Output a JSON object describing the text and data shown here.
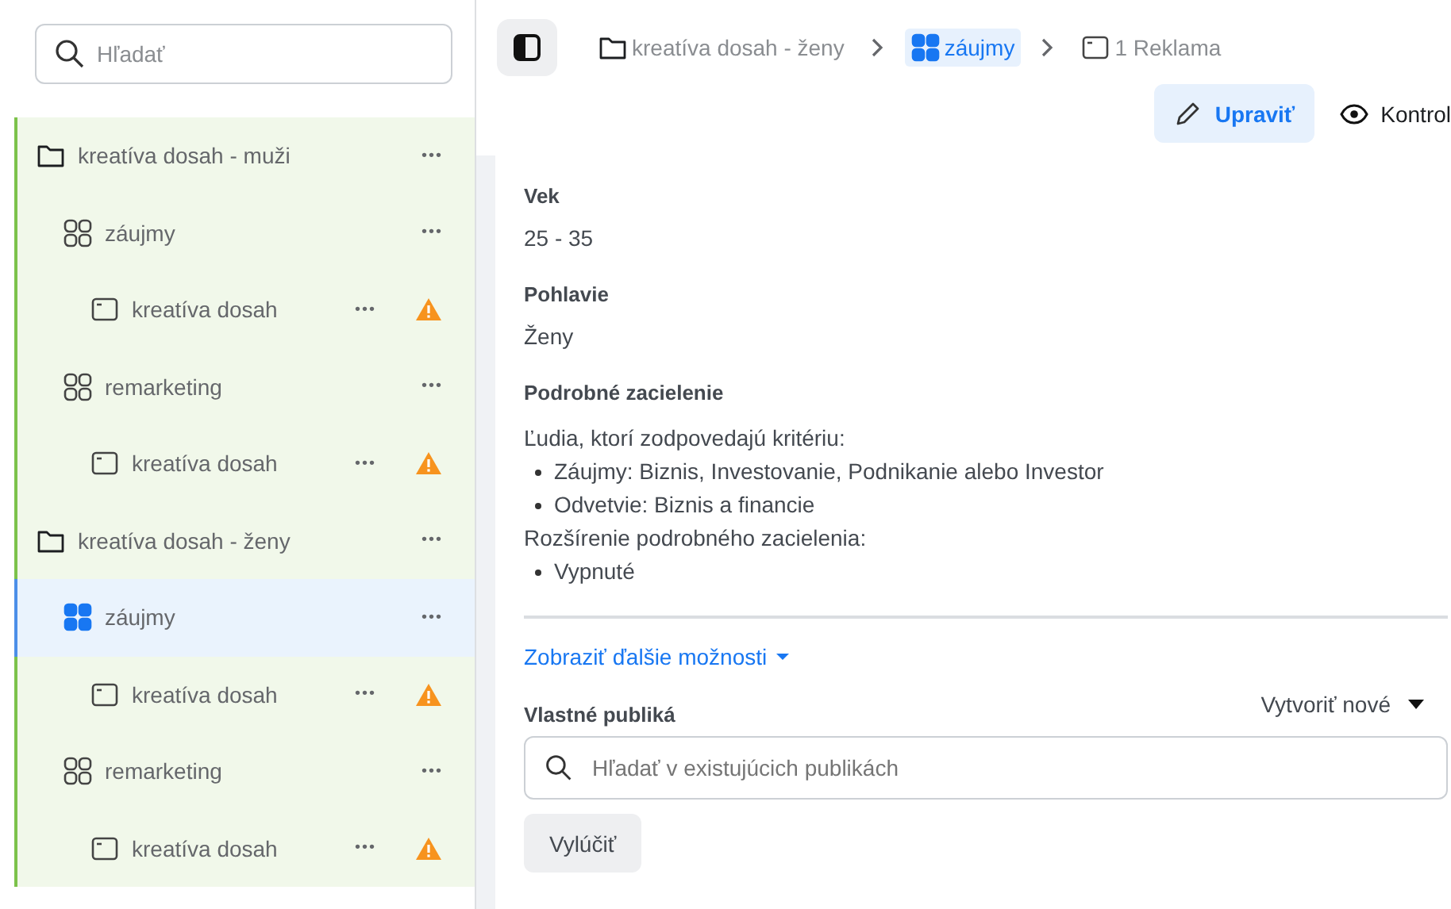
{
  "sidebar": {
    "search": {
      "placeholder": "Hľadať"
    },
    "tree": [
      {
        "kind": "folder",
        "label": "kreatíva dosah - muži",
        "selected": false,
        "more": "•••",
        "children": [
          {
            "kind": "adset",
            "label": "záujmy",
            "selected": false,
            "more": "•••",
            "children": [
              {
                "kind": "ad",
                "label": "kreatíva dosah",
                "selected": false,
                "more": "•••",
                "warning": true
              }
            ]
          },
          {
            "kind": "adset",
            "label": "remarketing",
            "selected": false,
            "more": "•••",
            "children": [
              {
                "kind": "ad",
                "label": "kreatíva dosah",
                "selected": false,
                "more": "•••",
                "warning": true
              }
            ]
          }
        ]
      },
      {
        "kind": "folder",
        "label": "kreatíva dosah - ženy",
        "selected": false,
        "more": "•••",
        "children": [
          {
            "kind": "adset",
            "label": "záujmy",
            "selected": true,
            "more": "•••",
            "children": [
              {
                "kind": "ad",
                "label": "kreatíva dosah",
                "selected": false,
                "more": "•••",
                "warning": true
              }
            ]
          },
          {
            "kind": "adset",
            "label": "remarketing",
            "selected": false,
            "more": "•••",
            "children": [
              {
                "kind": "ad",
                "label": "kreatíva dosah",
                "selected": false,
                "more": "•••",
                "warning": true
              }
            ]
          }
        ]
      }
    ]
  },
  "breadcrumbs": [
    {
      "kind": "folder",
      "label": "kreatíva dosah - ženy",
      "selected": false
    },
    {
      "kind": "adset",
      "label": "záujmy",
      "selected": true
    },
    {
      "kind": "ad",
      "label": "1 Reklama",
      "selected": false
    }
  ],
  "actions": [
    {
      "kind": "edit",
      "label": "Upraviť",
      "selected": true
    },
    {
      "kind": "review",
      "label": "Kontrol",
      "selected": false
    }
  ],
  "details": {
    "age": {
      "label": "Vek",
      "value": "25 - 35"
    },
    "gender": {
      "label": "Pohlavie",
      "value": "Ženy"
    },
    "targeting": {
      "label": "Podrobné zacielenie",
      "intro": "Ľudia, ktorí zodpovedajú kritériu:",
      "items": [
        "Záujmy: Biznis, Investovanie, Podnikanie alebo Investor",
        "Odvetvie: Biznis a financie"
      ],
      "expansion_label": "Rozšírenie podrobného zacielenia:",
      "expansion_items": [
        "Vypnuté"
      ]
    },
    "more_options": "Zobraziť ďalšie možnosti",
    "audiences": {
      "label": "Vlastné publiká",
      "create": "Vytvoriť nové",
      "search_placeholder": "Hľadať v existujúcich publikách",
      "exclude": "Vylúčiť"
    }
  }
}
